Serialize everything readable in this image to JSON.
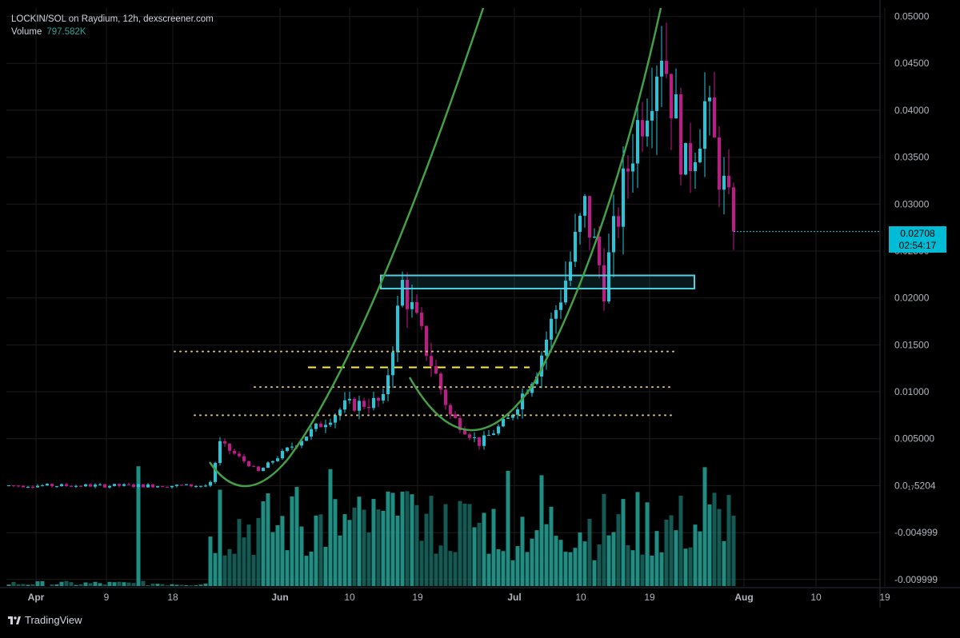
{
  "header": {
    "title": "LOCKIN/SOL on Raydium, 12h, dexscreener.com",
    "volume_label": "Volume",
    "volume_value": "797.582K"
  },
  "price_badge": {
    "price": "0.02708",
    "countdown": "02:54:17"
  },
  "brand": {
    "label": "TradingView"
  },
  "colors": {
    "up": "#26c6da",
    "down": "#c2188b",
    "volume": "#26a69a",
    "curve": "#43a047",
    "box": "#4dd0e1",
    "support": "#d8c07a",
    "mid_line": "#ffeb3b",
    "grid": "#1c1c1c",
    "axis_text": "#b2b5be"
  },
  "chart_data": {
    "type": "candlestick",
    "symbol": "LOCKIN/SOL",
    "interval": "12h",
    "price_axis": {
      "ticks": [
        "0.05000",
        "0.04500",
        "0.04000",
        "0.03500",
        "0.03000",
        "0.02500",
        "0.02000",
        "0.01500",
        "0.01000",
        "0.005000",
        "0.0₁₇5204",
        "-0.004999",
        "-0.009999"
      ],
      "values": [
        0.05,
        0.045,
        0.04,
        0.035,
        0.03,
        0.025,
        0.02,
        0.015,
        0.01,
        0.005,
        0.0,
        -0.005,
        -0.01
      ],
      "range": [
        -0.0107,
        0.0509
      ]
    },
    "time_axis": {
      "ticks": [
        "Apr",
        "9",
        "18",
        "Jun",
        "10",
        "19",
        "Jul",
        "10",
        "19",
        "Aug",
        "10",
        "19"
      ],
      "ticks_bold": [
        true,
        false,
        false,
        true,
        false,
        false,
        true,
        false,
        false,
        true,
        false,
        false
      ]
    },
    "candles_count": 152,
    "candles_start": "2024-03-31 (approx)",
    "ohlc_key_points": [
      {
        "idx": 0,
        "close": 0.0
      },
      {
        "idx": 42,
        "close": 0.0004
      },
      {
        "idx": 44,
        "close": 0.0045
      },
      {
        "idx": 52,
        "close": 0.0015
      },
      {
        "idx": 70,
        "close": 0.0085
      },
      {
        "idx": 78,
        "close": 0.009
      },
      {
        "idx": 82,
        "close": 0.0215
      },
      {
        "idx": 92,
        "close": 0.0075
      },
      {
        "idx": 98,
        "close": 0.0045
      },
      {
        "idx": 104,
        "close": 0.007
      },
      {
        "idx": 110,
        "close": 0.0125
      },
      {
        "idx": 116,
        "close": 0.022
      },
      {
        "idx": 120,
        "close": 0.0295
      },
      {
        "idx": 124,
        "close": 0.0215
      },
      {
        "idx": 130,
        "close": 0.0365
      },
      {
        "idx": 136,
        "close": 0.0475
      },
      {
        "idx": 141,
        "close": 0.0335
      },
      {
        "idx": 145,
        "close": 0.0405
      },
      {
        "idx": 151,
        "close": 0.02708
      }
    ],
    "last_price": 0.02708,
    "annotations": {
      "resistance_box": {
        "price_low": 0.021,
        "price_high": 0.0224
      },
      "support_levels": [
        0.0143,
        0.0105,
        0.0075
      ],
      "mid_level": 0.0126,
      "rounding_curves": 3
    }
  }
}
